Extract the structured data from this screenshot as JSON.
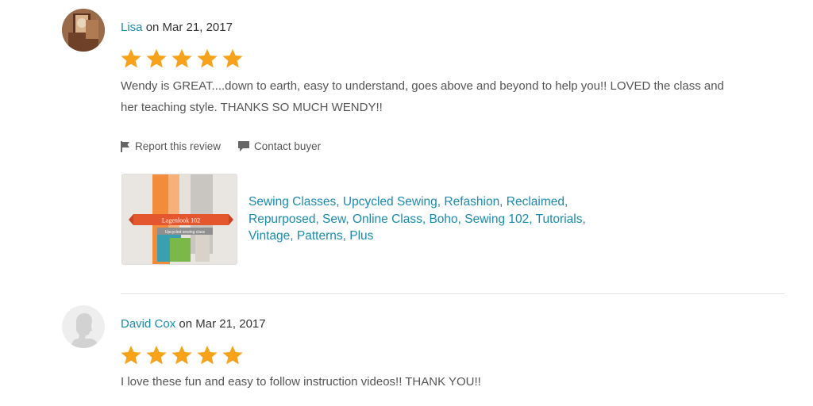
{
  "reviews": [
    {
      "reviewer": "Lisa",
      "date_text": "on Mar 21, 2017",
      "rating": 5,
      "text": "Wendy is GREAT....down to earth, easy to understand, goes above and beyond to help you!! LOVED the class and her teaching style. THANKS SO MUCH WENDY!!",
      "actions": {
        "report": "Report this review",
        "contact": "Contact buyer"
      },
      "listing": {
        "thumb_title": "Lagenlook 102",
        "thumb_subtitle": "Upcycled sewing class",
        "tags": "Sewing Classes, Upcycled Sewing, Refashion, Reclaimed, Repurposed, Sew, Online Class, Boho, Sewing 102, Tutorials, Vintage, Patterns, Plus"
      }
    },
    {
      "reviewer": "David Cox",
      "date_text": "on Mar 21, 2017",
      "rating": 5,
      "text": "I love these fun and easy to follow instruction videos!! THANK YOU!!"
    }
  ],
  "colors": {
    "link": "#1a8bb0",
    "star": "#f7a21b",
    "text": "#555555"
  },
  "icons": {
    "star": "star-icon",
    "flag": "flag-icon",
    "chat": "chat-bubble-icon"
  }
}
